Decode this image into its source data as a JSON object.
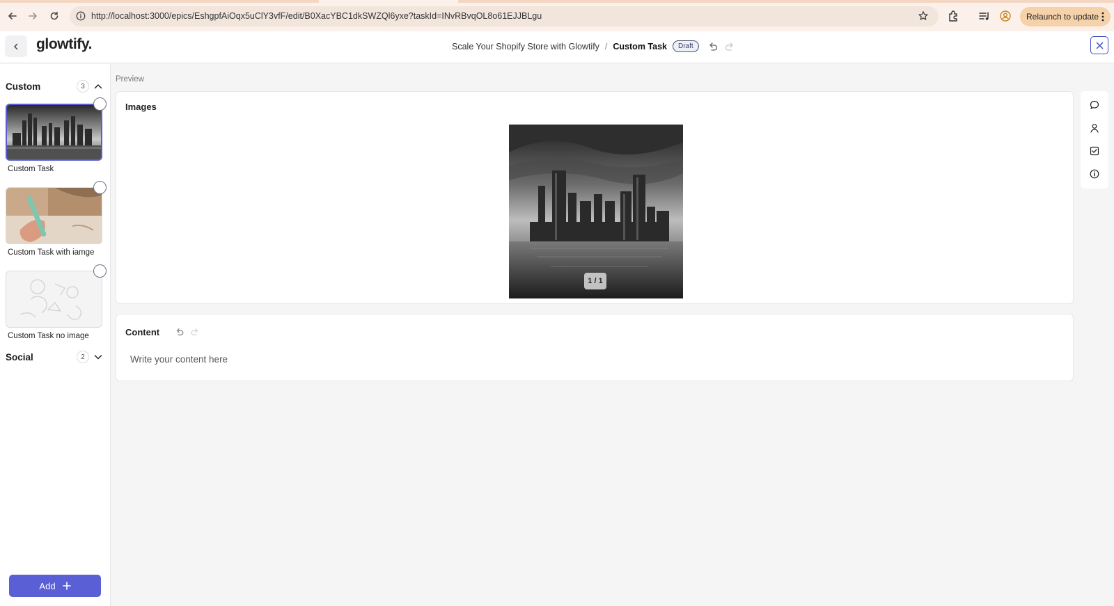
{
  "browser": {
    "url": "http://localhost:3000/epics/EshgpfAiOqx5uClY3vfF/edit/B0XacYBC1dkSWZQl6yxe?taskId=INvRBvqOL8o61EJJBLgu",
    "relaunch_label": "Relaunch to update"
  },
  "header": {
    "logo": "glowtify.",
    "breadcrumb_parent": "Scale Your Shopify Store with Glowtify",
    "breadcrumb_separator": "/",
    "breadcrumb_current": "Custom Task",
    "status_badge": "Draft"
  },
  "sidebar": {
    "groups": [
      {
        "title": "Custom",
        "count": "3",
        "expanded": true,
        "items": [
          {
            "label": "Custom Task",
            "thumbnail": "city-skyline-bw",
            "selected": true
          },
          {
            "label": "Custom Task with iamge",
            "thumbnail": "hand-writing-pen",
            "selected": false
          },
          {
            "label": "Custom Task no image",
            "thumbnail": "placeholder-sketch",
            "selected": false
          }
        ]
      },
      {
        "title": "Social",
        "count": "2",
        "expanded": false,
        "items": []
      }
    ],
    "add_label": "Add"
  },
  "main": {
    "preview_label": "Preview",
    "images_title": "Images",
    "image_pager": "1 / 1",
    "content_title": "Content",
    "content_placeholder": "Write your content here"
  },
  "rail": {
    "icons": [
      "comment-icon",
      "user-icon",
      "checkbox-icon",
      "info-icon"
    ]
  },
  "colors": {
    "accent": "#5b5fd6",
    "relaunch_bg": "#f6d2ab",
    "browser_bg": "#fbf1ea"
  }
}
